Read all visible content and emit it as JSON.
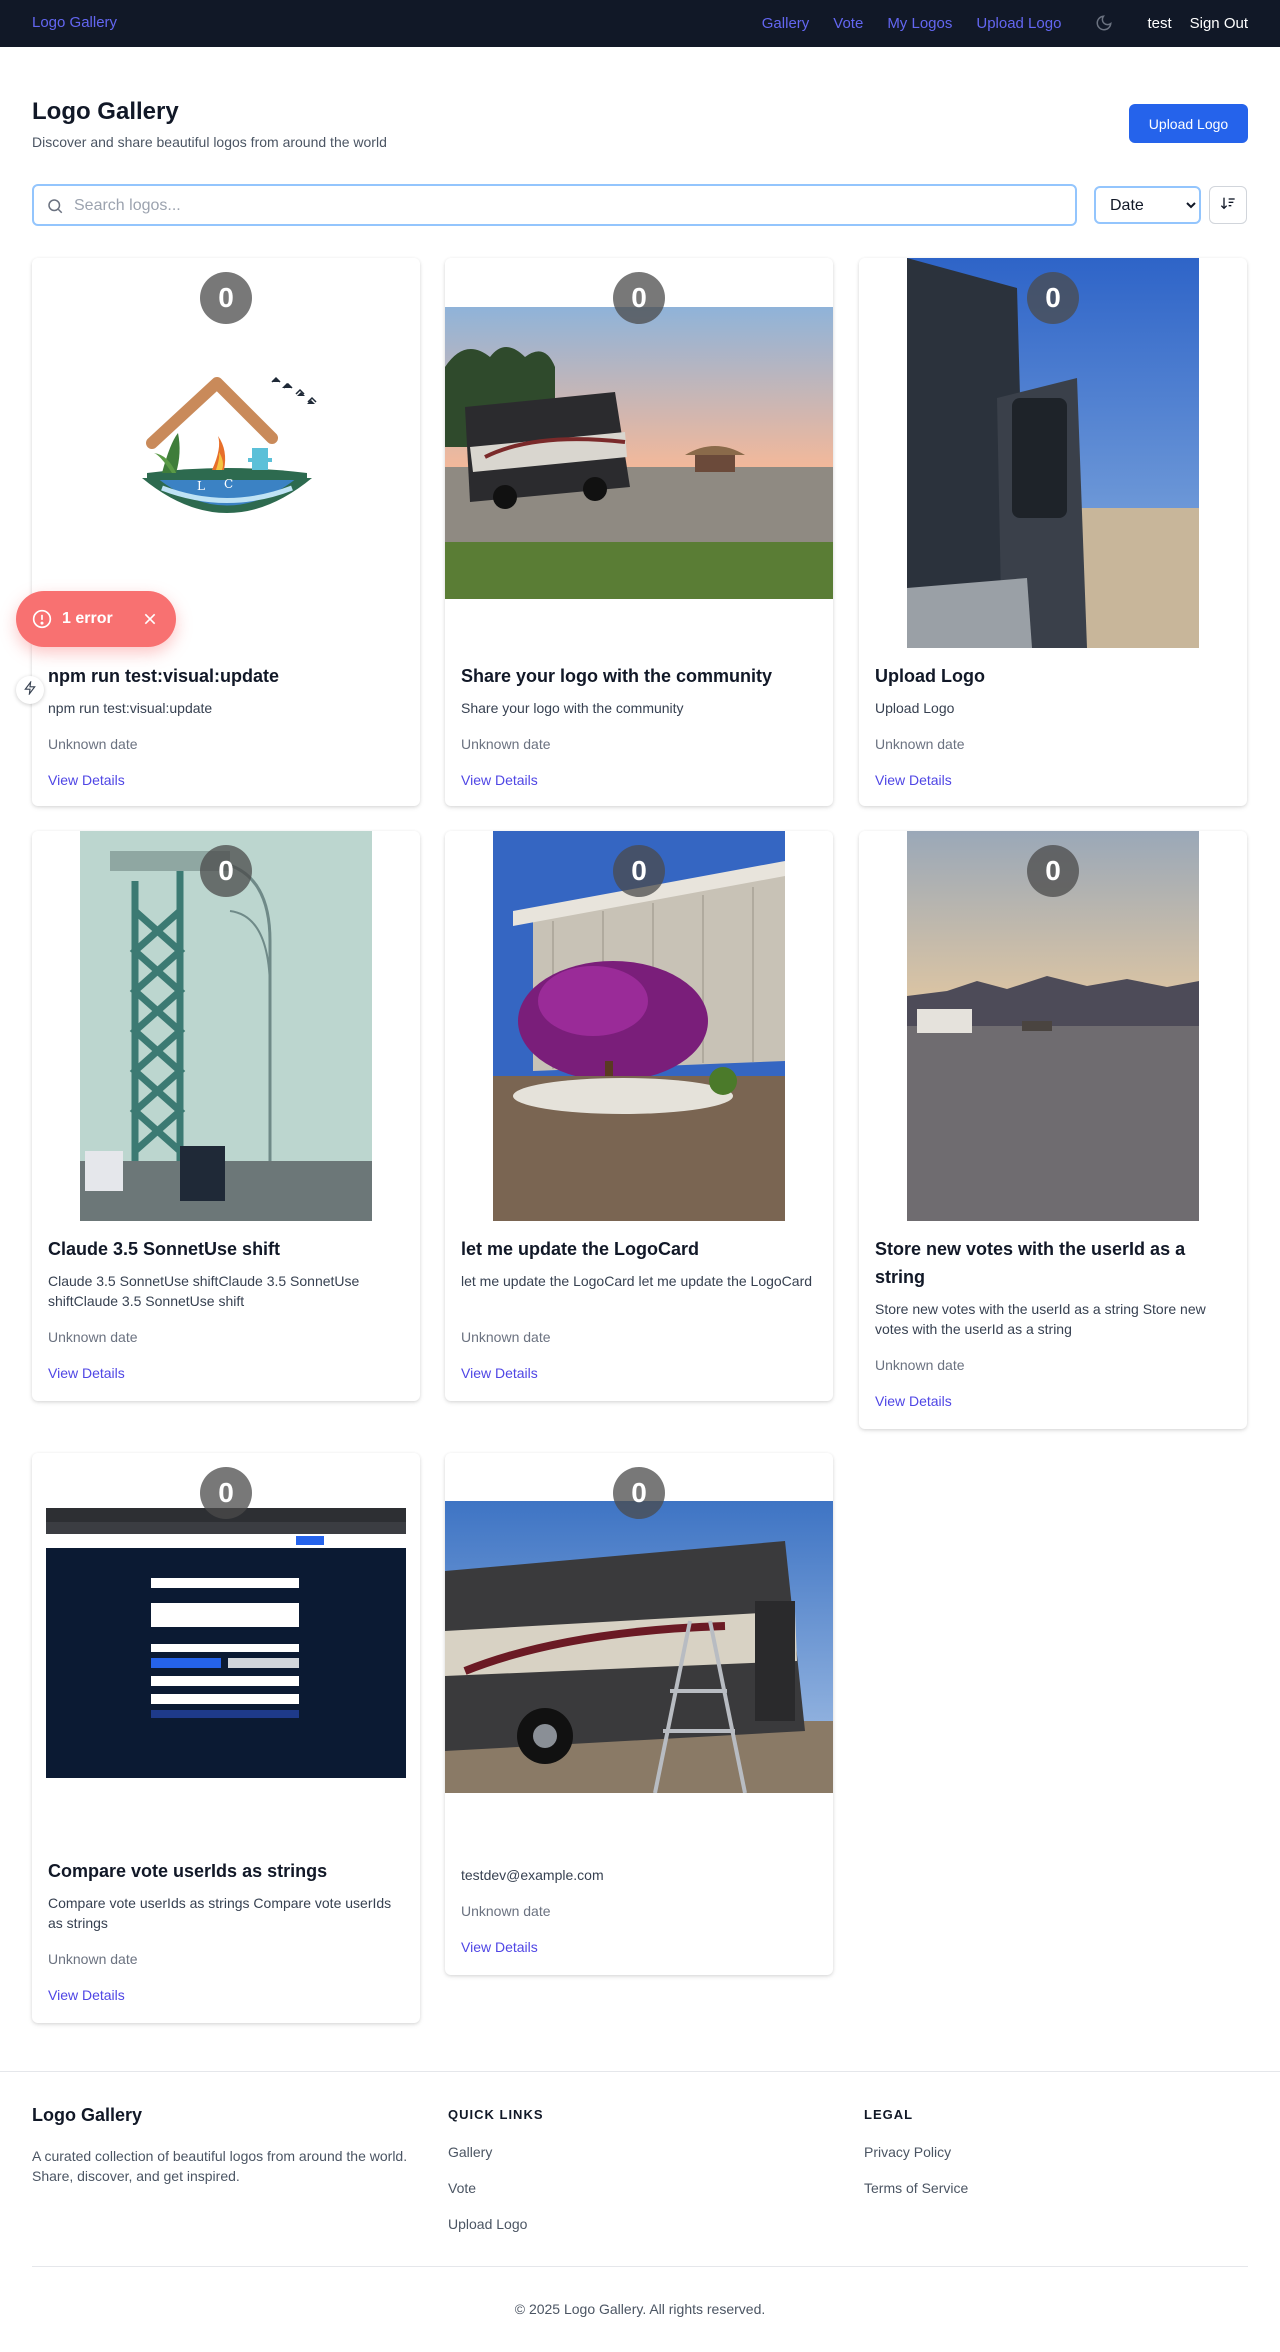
{
  "nav": {
    "brand": "Logo Gallery",
    "links": [
      "Gallery",
      "Vote",
      "My Logos",
      "Upload Logo"
    ],
    "theme_icon": "moon-icon",
    "user": "test",
    "sign_out": "Sign Out"
  },
  "header": {
    "title": "Logo Gallery",
    "subtitle": "Discover and share beautiful logos from around the world",
    "upload_button": "Upload Logo"
  },
  "search": {
    "placeholder": "Search logos...",
    "value": ""
  },
  "sort": {
    "selected": "Date",
    "direction_icon": "sort-descending-icon"
  },
  "cards": [
    {
      "votes": "0",
      "title": "npm run test:visual:update",
      "description": "npm run test:visual:update",
      "date": "Unknown date",
      "link": "View Details",
      "image": "lodge-logo-illustration"
    },
    {
      "votes": "0",
      "title": "Share your logo with the community",
      "description": "Share your logo with the community",
      "date": "Unknown date",
      "link": "View Details",
      "image": "motorhome-sunset-photo"
    },
    {
      "votes": "0",
      "title": "Upload Logo",
      "description": "Upload Logo",
      "date": "Unknown date",
      "link": "View Details",
      "image": "rv-door-desert-photo"
    },
    {
      "votes": "0",
      "title": "Claude 3.5 SonnetUse shift",
      "description": "Claude 3.5 SonnetUse shiftClaude 3.5 SonnetUse shiftClaude 3.5 SonnetUse shift",
      "date": "Unknown date",
      "link": "View Details",
      "image": "ambassador-bridge-photo"
    },
    {
      "votes": "0",
      "title": "let me update the LogoCard",
      "description": "let me update the LogoCard let me update the LogoCard",
      "date": "Unknown date",
      "link": "View Details",
      "image": "flowering-tree-photo"
    },
    {
      "votes": "0",
      "title": "Store new votes with the userId as a string",
      "description": "Store new votes with the userId as a string Store new votes with the userId as a string",
      "date": "Unknown date",
      "link": "View Details",
      "image": "desert-mountains-photo"
    },
    {
      "votes": "0",
      "title": "Compare vote userIds as strings",
      "description": "Compare vote userIds as strings Compare vote userIds as strings",
      "date": "Unknown date",
      "link": "View Details",
      "image": "upload-form-screenshot"
    },
    {
      "votes": "0",
      "title": "",
      "description": "testdev@example.com",
      "date": "Unknown date",
      "link": "View Details",
      "image": "motorhome-ladder-photo"
    }
  ],
  "error_toast": {
    "label": "1 error",
    "icon": "alert-circle-icon",
    "close_icon": "close-icon"
  },
  "dev_indicator_icon": "lightning-icon",
  "footer": {
    "brand": "Logo Gallery",
    "about": "A curated collection of beautiful logos from around the world. Share, discover, and get inspired.",
    "quick_links_heading": "QUICK LINKS",
    "quick_links": [
      "Gallery",
      "Vote",
      "Upload Logo"
    ],
    "legal_heading": "LEGAL",
    "legal_links": [
      "Privacy Policy",
      "Terms of Service"
    ],
    "copyright": "© 2025 Logo Gallery. All rights reserved."
  },
  "colors": {
    "nav_bg": "#111827",
    "nav_link": "#6366f1",
    "primary": "#2563eb",
    "link": "#4f46e5",
    "error": "#f87171"
  }
}
